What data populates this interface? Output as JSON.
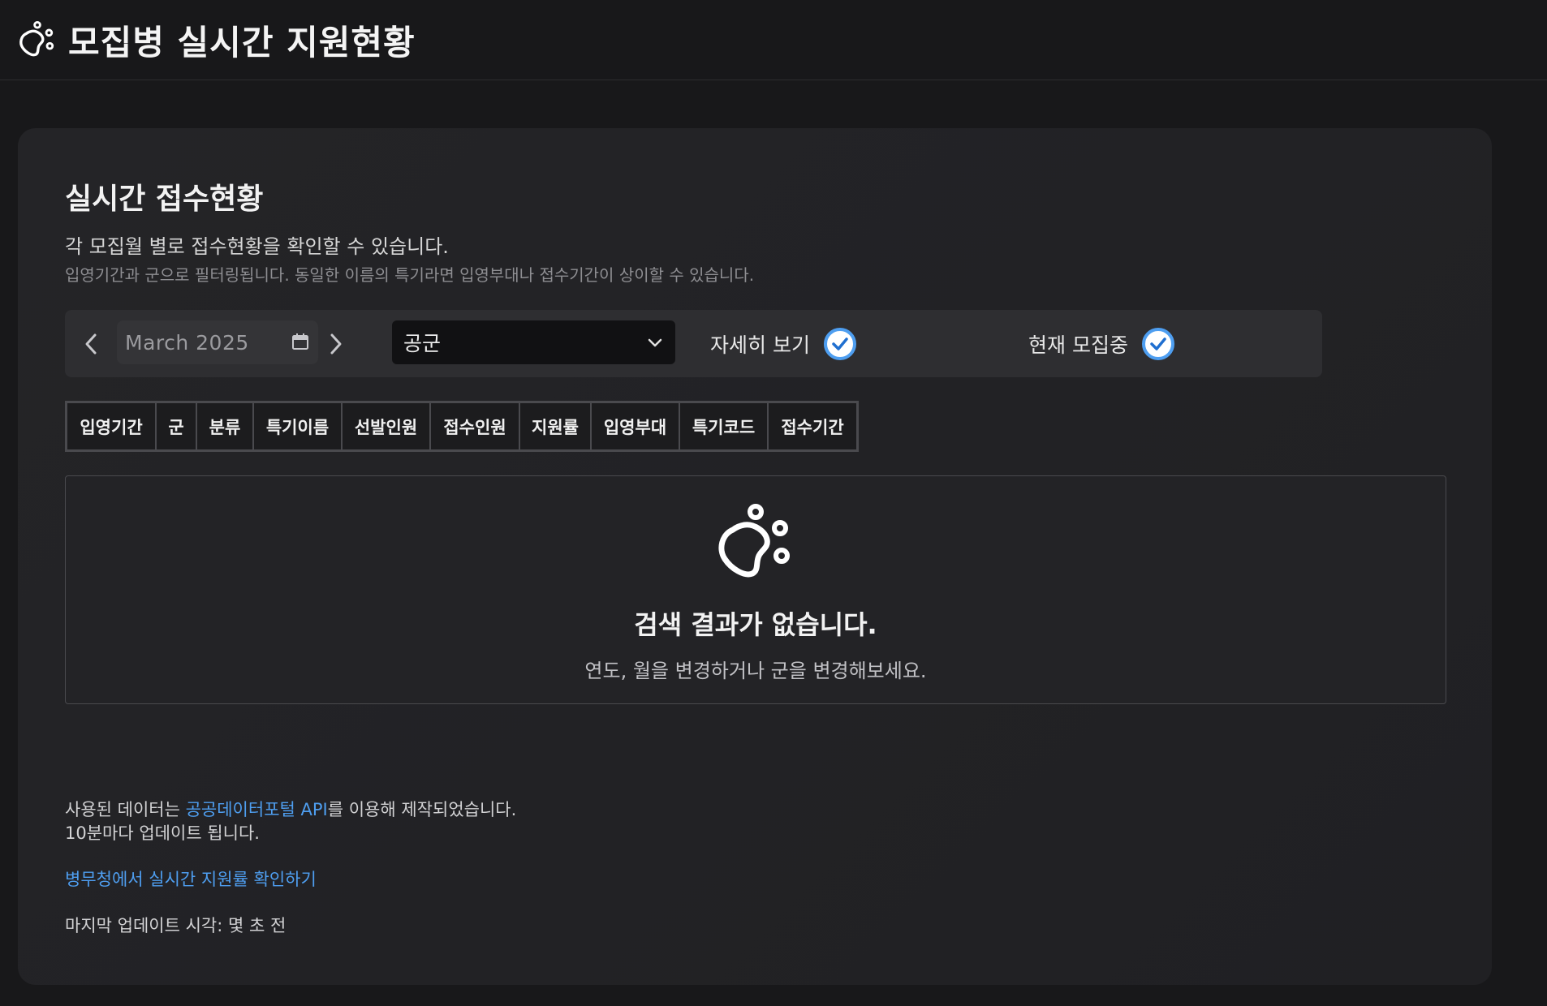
{
  "header": {
    "title": "모집병 실시간 지원현황",
    "logo_icon": "paw-icon"
  },
  "section": {
    "title": "실시간 접수현황",
    "description": "각 모집월 별로 접수현황을 확인할 수 있습니다.",
    "note": "입영기간과 군으로 필터링됩니다. 동일한 이름의 특기라면 입영부대나 접수기간이 상이할 수 있습니다."
  },
  "filters": {
    "month_value": "March 2025",
    "branch_value": "공군",
    "detail_toggle": {
      "label": "자세히 보기",
      "checked": true
    },
    "open_toggle": {
      "label": "현재 모집중",
      "checked": true
    }
  },
  "table": {
    "columns": [
      "입영기간",
      "군",
      "분류",
      "특기이름",
      "선발인원",
      "접수인원",
      "지원률",
      "입영부대",
      "특기코드",
      "접수기간"
    ]
  },
  "empty_state": {
    "title": "검색 결과가 없습니다.",
    "hint": "연도, 월을 변경하거나 군을 변경해보세요."
  },
  "footer": {
    "data_prefix": "사용된 데이터는 ",
    "data_link": "공공데이터포털 API",
    "data_suffix": "를 이용해 제작되었습니다.",
    "update_interval": "10분마다 업데이트 됩니다.",
    "mma_link": "병무청에서 실시간 지원률 확인하기",
    "last_update": "마지막 업데이트 시각: 몇 초 전"
  },
  "colors": {
    "accent": "#4e9ef0",
    "background": "#18181a",
    "card": "#242427"
  }
}
